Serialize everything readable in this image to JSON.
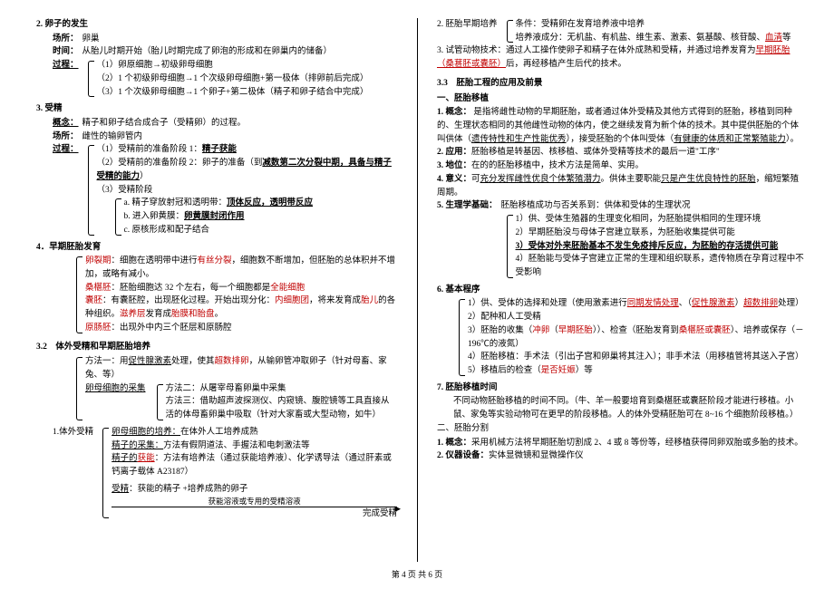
{
  "left": {
    "s2_title": "2. 卵子的发生",
    "place_lbl": "场所：",
    "place_val": "卵巢",
    "time_lbl": "时间：",
    "time_val": "从胎儿时期开始（胎儿时期完成了卵泡的形成和在卵巢内的储备）",
    "proc_lbl": "过程：",
    "p1": "（1）卵原细胞→初级卵母细胞",
    "p2": "（2）1 个初级卵母细胞→1 个次级卵母细胞+第一极体（排卵前后完成）",
    "p3": "（3）1 个次级卵母细胞→1 个卵子+第二极体（精子和卵子结合中完成）",
    "s3_title": "3. 受精",
    "concept_lbl": "概念：",
    "concept_val": "精子和卵子结合成合子（受精卵）的过程。",
    "place2_lbl": "场所：",
    "place2_val": "雌性的输卵管内",
    "proc2_lbl": "过程：",
    "q1a": "（1）受精前的准备阶段 1：",
    "q1b": "精子获能",
    "q2a": "（2）受精前的准备阶段 2：卵子的准备（到",
    "q2b": "减数第二次分裂中期，具备与精子受精的能力",
    "q2c": "）",
    "q3": "（3）受精阶段",
    "ra": "a. 精子穿放射冠和透明带：",
    "rb": "顶体反应，透明带反应",
    "sa": "b. 进入卵黄膜：",
    "sb": "卵黄膜封闭作用",
    "t": "c. 原核形成和配子结合",
    "s4_title": "4．早期胚胎发育",
    "dev1a": "卵裂期",
    "dev1b": "：细胞在透明带中进行",
    "dev1c": "有丝分裂",
    "dev1d": "，细胞数不断增加，但胚胎的总体积并不增加，或略有减小。",
    "dev2a": "桑椹胚",
    "dev2b": "：胚胎细胞达 32 个左右，每一个细胞都是",
    "dev2c": "全能细胞",
    "dev3a": "囊胚",
    "dev3b": "：有囊胚腔，出现胚化过程。开始出现分化：",
    "dev3c": "内细胞团",
    "dev3d": "，将来发育成",
    "dev3e": "胎儿",
    "dev3f": "的各种组织。",
    "dev3g": "滋养层",
    "dev3h": "发育成",
    "dev3i": "胎膜和胎盘",
    "dev3j": "。",
    "dev4a": "原肠胚",
    "dev4b": "：出现外中内三个胚层和原肠腔",
    "s32_title": "3.2　体外受精和早期胚胎培养",
    "m1a": "方法一：用",
    "m1b": "促性腺激素",
    "m1c": "处理，使其",
    "m1d": "超数排卵",
    "m1e": "，从输卵管冲取卵子（针对母畜、家兔、等）",
    "m_seg_lbl": "卵母细胞的采集",
    "m2": "方法二：从屠宰母畜卵巢中采集",
    "m3": "方法三：借助超声波探测仪、内窥镜、腹腔镜等工具直接从活的体母畜卵巢中吸取（针对大家畜或大型动物，如牛）",
    "ivf_head": "1.体外受精",
    "n1_lbl": "卵母细胞的培养：",
    "n1_val": "在体外人工培养成熟",
    "n2_lbl": "精子的采集：",
    "n2_val": "方法有假阴道法、手握法和电刺激法等",
    "n3a": "精子的",
    "n3b": "获能",
    "n3c": "：方法有培养法（通过获能培养液）、化学诱导法（通过肝素或钙离子载体 A23187）",
    "r_lbl": "受精",
    "r_a": "：获能的精子 +培养成熟的卵子",
    "r_arrow": "获能溶液或专用的受精溶液",
    "r_b": "完成受精"
  },
  "right": {
    "e1_lbl": "2. 胚胎早期培养",
    "e1a": "条件：受精卵在发育培养液中培养",
    "e1b": "培养液成分：无机盐、有机盐、维生素、激素、氨基酸、核苷酸、",
    "e1c": "血清",
    "e1d": "等",
    "e2a": "3. 试管动物技术：通过人工操作使卵子和精子在体外成熟和受精，并通过培养发育为",
    "e2b": "早期胚胎（桑葚胚或囊胚）",
    "e2c": "后，再经移植产生后代的技术。",
    "s33_title": "3.3　胚胎工程的应用及前景",
    "h1": "一、胚胎移植",
    "c_lbl": "1. 概念：",
    "c_a": "是指将雌性动物的早期胚胎，或者通过体外受精及其他方式得到的胚胎，移植到同种的、生理状态相同的其他雌性动物的体内，使之继续发育为新个体的技术。其中提供胚胎的个体叫供体（",
    "c_b": "遗传特性和生产性能优秀",
    "c_c": "），接受胚胎的个体叫受体（",
    "c_d": "有健康的体质和正常繁殖能力",
    "c_e": "）。",
    "app_lbl": "2. 应用：",
    "app_val": "胚胎移植是转基因、核移植、或体外受精等技术的最后一道\"工序\"",
    "mean_lbl": "3. 地位：",
    "mean_val": "在的的胚胎移植中，技术方法是简单、实用。",
    "sig_lbl": "4. 意义：",
    "sig_a": "可",
    "sig_b": "充分发挥雌性优良个体繁殖潜力",
    "sig_c": "。供体主要职能",
    "sig_d": "只是产生优良特性的胚胎",
    "sig_e": "，缩短繁殖周期。",
    "phys_lbl": "5. 生理学基础：",
    "phys_head": "胚胎移植成功与否关系到：供体和受体的生理状况",
    "ph1": "1）供、受体生殖器的生理变化相同，为胚胎提供相同的生理环境",
    "ph2": "2）早期胚胎没与母体子宫建立联系，为胚胎收集提供可能",
    "ph3": "3）受体对外来胚胎基本不发生免疫排斥反应，为胚胎的存活提供可能",
    "ph4": "4）胚胎能与受体子宫建立正常的生理和组织联系，遗传物质在孕育过程中不受影响",
    "bp_lbl": "6. 基本程序",
    "bp1a": "1）供、受体的选择和处理（使用激素进行",
    "bp1b": "同期发情处理",
    "bp1c": "、（",
    "bp1d": "促性腺激素",
    "bp1e": "）",
    "bp1f": "超数排卵",
    "bp1g": "处理）",
    "bp2": "2）配种和人工受精",
    "bp3a": "3）胚胎的收集（",
    "bp3b": "冲卵",
    "bp3c": "（",
    "bp3d": "早期胚胎",
    "bp3e": "））、检查（胚胎发育到",
    "bp3f": "桑椹胚或囊胚",
    "bp3g": "）、培养或保存（－196℃的液氮）",
    "bp4": "4）胚胎移植：手术法（引出子宫和卵巢将其注入）；非手术法（用移植管将其送入子宫）",
    "bp5a": "5）移植后的检查（",
    "bp5b": "是否妊娠",
    "bp5c": "）等",
    "tm_lbl": "7. 胚胎移植时间",
    "tm_val": "不同动物胚胎移植的时间不同。（牛、羊一般要培育到桑椹胚或囊胚阶段才能进行移植。小鼠、家兔等实验动物可在更早的阶段移植。人的体外受精胚胎可在 8~16 个细胞阶段移植。）",
    "split_h": "二、胚胎分割",
    "sp_lbl": "1. 概念：",
    "sp_val": "采用机械方法将早期胚胎切割成 2、4 或 8 等份等，经移植获得同卵双胎或多胎的技术。",
    "eq_lbl": "2. 仪器设备：",
    "eq_val": "实体显微镜和显微操作仪"
  },
  "footer": "第 4 页 共 6 页"
}
